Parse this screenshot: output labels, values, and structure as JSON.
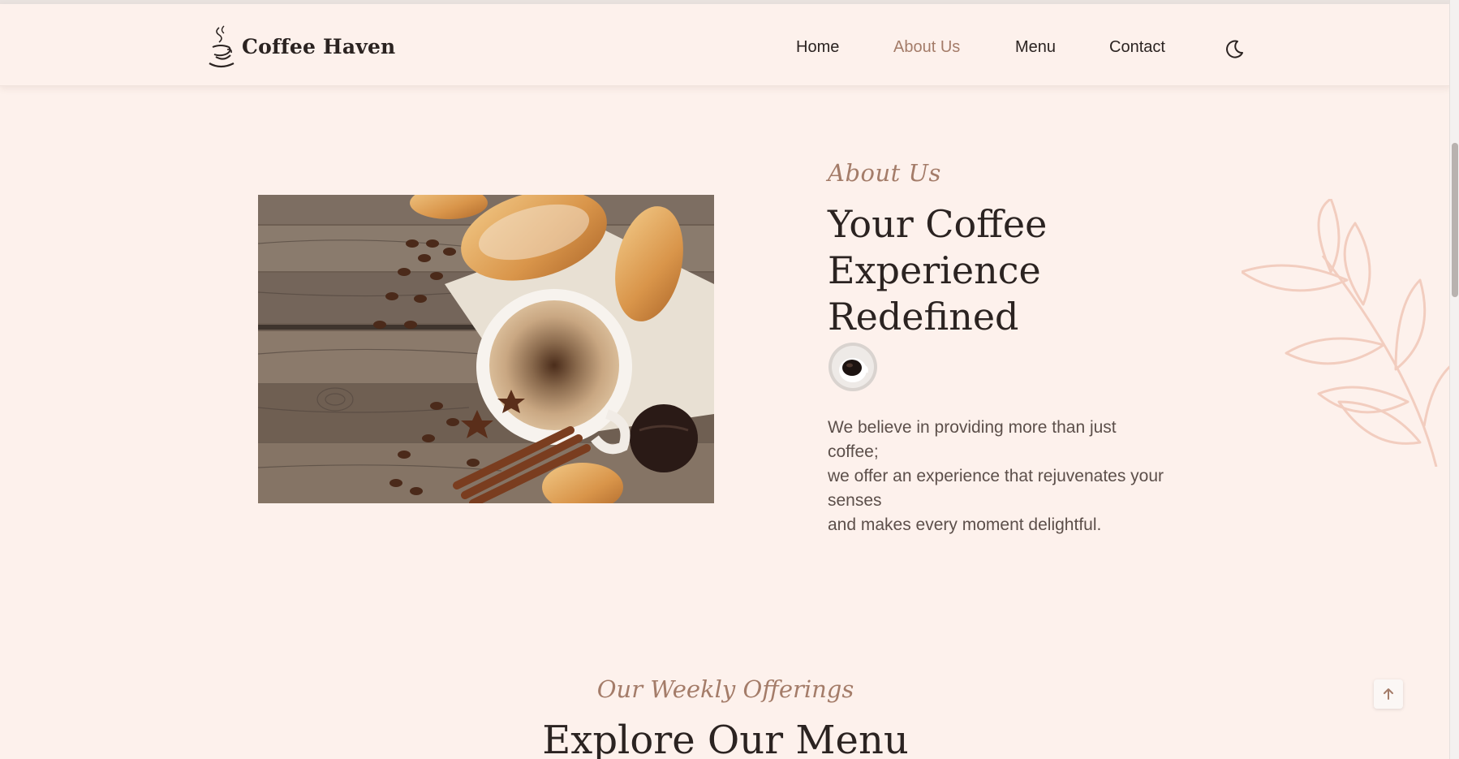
{
  "brand": {
    "name": "Coffee Haven",
    "logo_icon": "coffee-cup-steam-icon"
  },
  "nav": {
    "items": [
      {
        "label": "Home",
        "active": false
      },
      {
        "label": "About Us",
        "active": true
      },
      {
        "label": "Menu",
        "active": false
      },
      {
        "label": "Contact",
        "active": false
      }
    ],
    "theme_toggle_icon": "moon-icon"
  },
  "about": {
    "eyebrow": "About Us",
    "title": "Your Coffee Experience Redefined",
    "cup_icon": "coffee-cup-icon",
    "text_lines": [
      "We believe in providing more than just",
      "coffee;",
      "we offer an experience that rejuvenates your",
      "senses",
      "and makes every moment delightful."
    ],
    "image_subject": "cappuccino-with-croissants-photo"
  },
  "menu_section": {
    "eyebrow": "Our Weekly Offerings",
    "title": "Explore Our Menu"
  },
  "back_to_top_icon": "arrow-up-icon",
  "colors": {
    "background": "#fdf1ec",
    "accent": "#a47c69",
    "heading": "#2b2321",
    "body_text": "#5c4f4a",
    "leaf": "#f2cdbf"
  }
}
